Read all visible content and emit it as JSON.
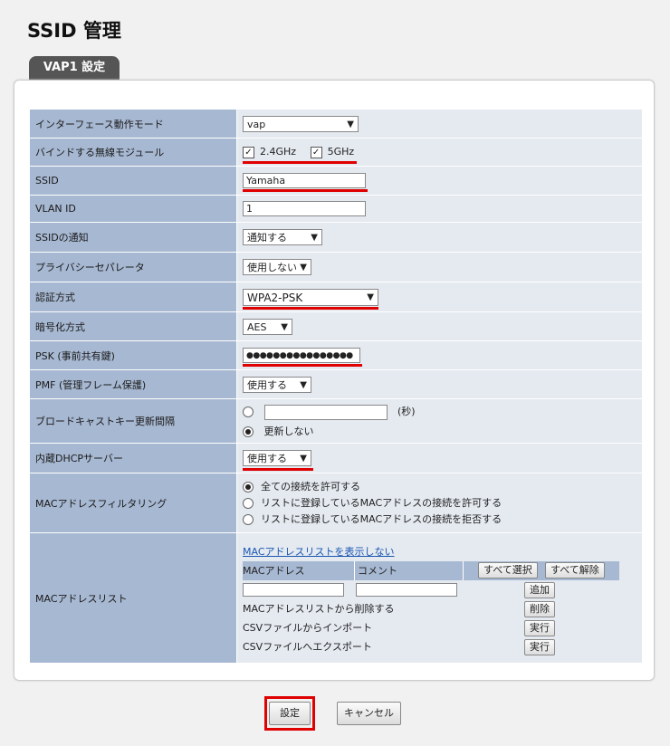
{
  "page_title": "SSID 管理",
  "tab_label": "VAP1 設定",
  "rows": {
    "interface_mode": {
      "label": "インターフェース動作モード",
      "value": "vap"
    },
    "radio_module": {
      "label": "バインドする無線モジュール",
      "opt1": "2.4GHz",
      "opt2": "5GHz"
    },
    "ssid": {
      "label": "SSID",
      "value": "Yamaha"
    },
    "vlan_id": {
      "label": "VLAN ID",
      "value": "1"
    },
    "ssid_notify": {
      "label": "SSIDの通知",
      "value": "通知する"
    },
    "privacy_sep": {
      "label": "プライバシーセパレータ",
      "value": "使用しない"
    },
    "auth": {
      "label": "認証方式",
      "value": "WPA2-PSK"
    },
    "enc": {
      "label": "暗号化方式",
      "value": "AES"
    },
    "psk": {
      "label": "PSK (事前共有鍵)",
      "value": "●●●●●●●●●●●●●●●●"
    },
    "pmf": {
      "label": "PMF (管理フレーム保護)",
      "value": "使用する"
    },
    "broadcast_key": {
      "label": "ブロードキャストキー更新間隔",
      "unit": "(秒)",
      "no_update": "更新しない"
    },
    "dhcp": {
      "label": "内蔵DHCPサーバー",
      "value": "使用する"
    },
    "mac_filter": {
      "label": "MACアドレスフィルタリング",
      "opt1": "全ての接続を許可する",
      "opt2": "リストに登録しているMACアドレスの接続を許可する",
      "opt3": "リストに登録しているMACアドレスの接続を拒否する"
    },
    "mac_list": {
      "label": "MACアドレスリスト",
      "hide_link": "MACアドレスリストを表示しない",
      "col_mac": "MACアドレス",
      "col_comment": "コメント",
      "select_all": "すべて選択",
      "deselect_all": "すべて解除",
      "add": "追加",
      "delete_label": "MACアドレスリストから削除する",
      "delete_btn": "削除",
      "import_label": "CSVファイルからインポート",
      "import_btn": "実行",
      "export_label": "CSVファイルへエクスポート",
      "export_btn": "実行"
    }
  },
  "buttons": {
    "save": "設定",
    "cancel": "キャンセル"
  },
  "colors": {
    "label_bg": "#a7b8d2",
    "value_bg": "#e5eaf1",
    "highlight": "#e00000"
  }
}
